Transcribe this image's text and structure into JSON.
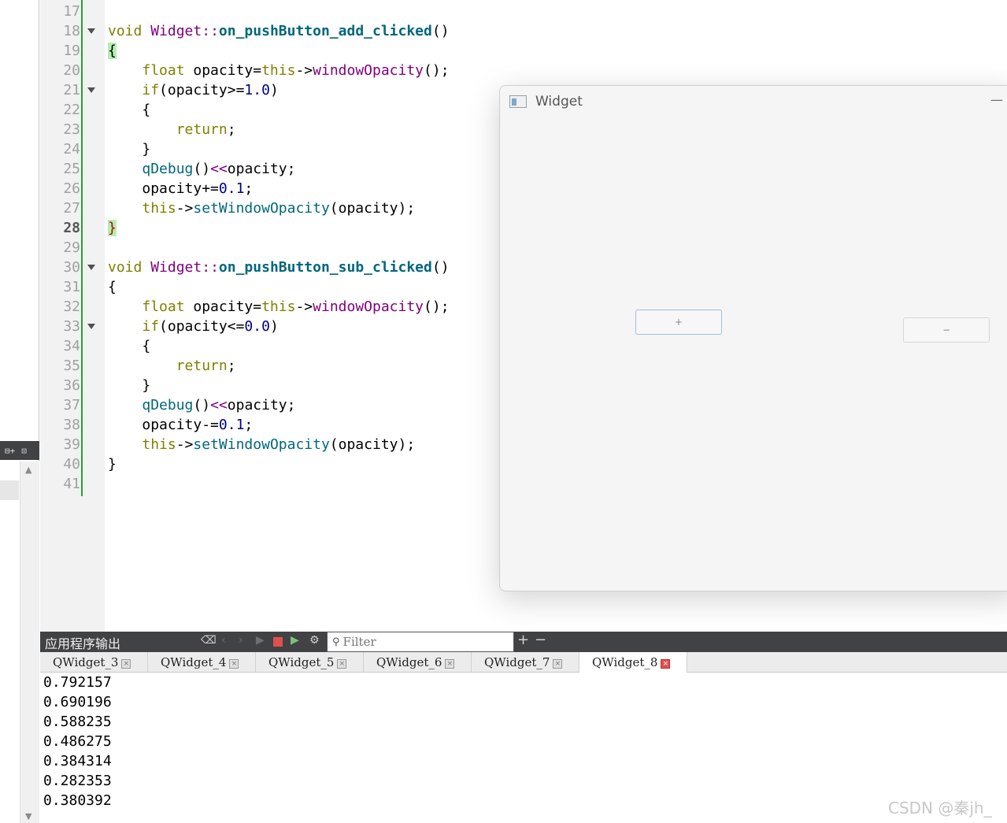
{
  "left_panel": {
    "toolbar_icon_1": "⊟+",
    "toolbar_icon_2": "⊡"
  },
  "editor": {
    "line_numbers": [
      "17",
      "18",
      "19",
      "20",
      "21",
      "22",
      "23",
      "24",
      "25",
      "26",
      "27",
      "28",
      "29",
      "30",
      "31",
      "32",
      "33",
      "34",
      "35",
      "36",
      "37",
      "38",
      "39",
      "40",
      "41"
    ],
    "current_line": "28",
    "lines": {
      "l18_kw": "void",
      "l18_cls": "Widget",
      "l18_sep": "::",
      "l18_fn": "on_pushButton_add_clicked",
      "l18_parens": "()",
      "l19_brace": "{",
      "l20_kw": "float",
      "l20_a": " opacity=",
      "l20_this": "this",
      "l20_b": "->",
      "l20_call": "windowOpacity",
      "l20_c": "();",
      "l21_kw": "if",
      "l21_a": "(opacity>=",
      "l21_num": "1.0",
      "l21_b": ")",
      "l22": "{",
      "l23_kw": "return",
      "l23_a": ";",
      "l24": "}",
      "l25_call": "qDebug",
      "l25_a": "()",
      "l25_op": "<<",
      "l25_b": "opacity;",
      "l26_a": "opacity+=",
      "l26_num": "0.1",
      "l26_b": ";",
      "l27_this": "this",
      "l27_a": "->",
      "l27_call": "setWindowOpacity",
      "l27_b": "(opacity);",
      "l28_brace": "}",
      "l30_kw": "void",
      "l30_cls": "Widget",
      "l30_sep": "::",
      "l30_fn": "on_pushButton_sub_clicked",
      "l30_parens": "()",
      "l31": "{",
      "l32_kw": "float",
      "l32_a": " opacity=",
      "l32_this": "this",
      "l32_b": "->",
      "l32_call": "windowOpacity",
      "l32_c": "();",
      "l33_kw": "if",
      "l33_a": "(opacity<=",
      "l33_num": "0.0",
      "l33_b": ")",
      "l34": "{",
      "l35_kw": "return",
      "l35_a": ";",
      "l36": "}",
      "l37_call": "qDebug",
      "l37_a": "()",
      "l37_op": "<<",
      "l37_b": "opacity;",
      "l38_a": "opacity-=",
      "l38_num": "0.1",
      "l38_b": ";",
      "l39_this": "this",
      "l39_a": "->",
      "l39_call": "setWindowOpacity",
      "l39_b": "(opacity);",
      "l40": "}"
    }
  },
  "widget_window": {
    "title": "Widget",
    "minimize_label": "—",
    "add_button_label": "+",
    "sub_button_label": "−"
  },
  "output": {
    "title": "应用程序输出",
    "filter_placeholder": "Filter",
    "plus_label": "+",
    "minus_label": "−",
    "tabs": [
      {
        "label": "QWidget_3"
      },
      {
        "label": "QWidget_4"
      },
      {
        "label": "QWidget_5"
      },
      {
        "label": "QWidget_6"
      },
      {
        "label": "QWidget_7"
      },
      {
        "label": "QWidget_8"
      }
    ],
    "active_tab": "QWidget_8",
    "lines": [
      "0.792157",
      "0.690196",
      "0.588235",
      "0.486275",
      "0.384314",
      "0.282353",
      "0.380392"
    ]
  },
  "watermark": "CSDN @秦jh_",
  "colors": {
    "gutter_marker": "#2ba02b",
    "keyword": "#808000",
    "class": "#800080",
    "function": "#00677c",
    "number": "#000080",
    "output_header_bg": "#404244"
  }
}
